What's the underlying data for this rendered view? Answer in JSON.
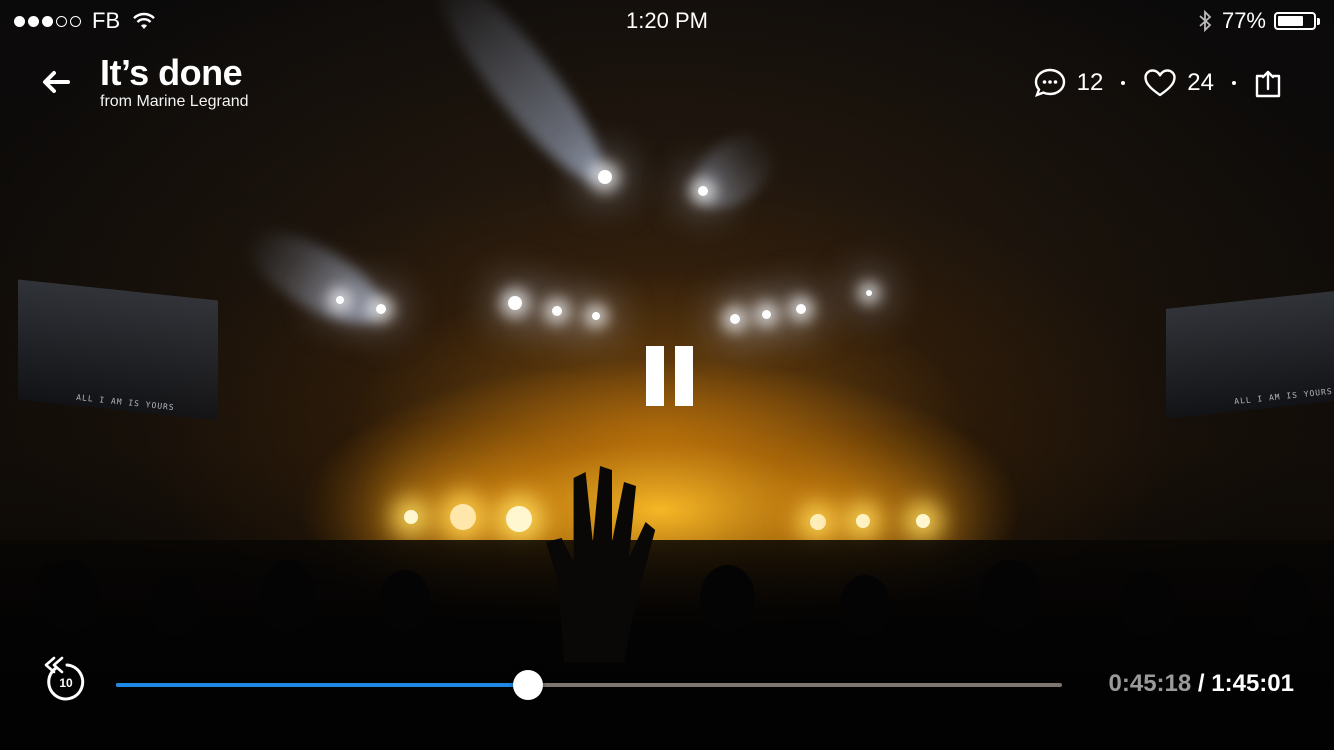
{
  "status_bar": {
    "carrier": "FB",
    "signal_bars_filled": 3,
    "signal_bars_total": 5,
    "time": "1:20 PM",
    "battery_percent": "77%",
    "battery_level": 0.77,
    "icons": [
      "wifi-icon",
      "bluetooth-icon",
      "battery-icon"
    ]
  },
  "header": {
    "back_icon": "back-arrow-icon",
    "title": "It’s done",
    "subtitle": "from Marine Legrand",
    "comments_count": "12",
    "likes_count": "24",
    "comment_icon": "comment-icon",
    "like_icon": "heart-icon",
    "share_icon": "share-icon"
  },
  "background": {
    "screen_text_left": "ALL I AM IS YOURS",
    "screen_text_right": "ALL I AM IS YOURS"
  },
  "player": {
    "state_icon": "pause-icon",
    "replay_label": "10",
    "replay_icon": "replay-10-icon",
    "current_time": "0:45:18",
    "separator": "/",
    "total_time": "1:45:01",
    "progress": 0.4357,
    "colors": {
      "progress": "#1e88e5",
      "track": "#7c7670",
      "thumb": "#ffffff"
    }
  }
}
